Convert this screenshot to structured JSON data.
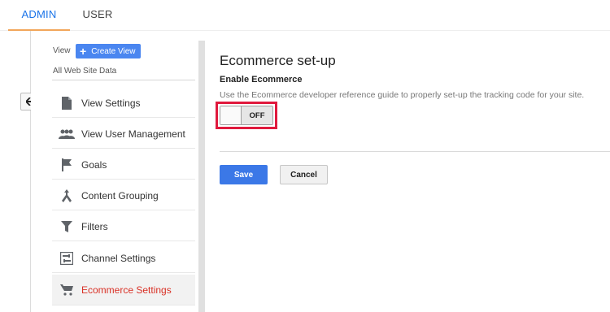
{
  "tabs": [
    {
      "label": "ADMIN",
      "active": true
    },
    {
      "label": "USER",
      "active": false
    }
  ],
  "sidebar": {
    "view_label": "View",
    "create_view_label": "Create View",
    "property_name": "All Web Site Data",
    "items": [
      {
        "label": "View Settings",
        "icon": "document-icon"
      },
      {
        "label": "View User Management",
        "icon": "people-icon"
      },
      {
        "label": "Goals",
        "icon": "flag-icon"
      },
      {
        "label": "Content Grouping",
        "icon": "grouping-icon"
      },
      {
        "label": "Filters",
        "icon": "filter-icon"
      },
      {
        "label": "Channel Settings",
        "icon": "channel-icon"
      },
      {
        "label": "Ecommerce Settings",
        "icon": "cart-icon",
        "active": true
      }
    ]
  },
  "main": {
    "title": "Ecommerce set-up",
    "subtitle": "Enable Ecommerce",
    "description": "Use the Ecommerce developer reference guide to properly set-up the tracking code for your site.",
    "toggle_state": "OFF",
    "save_label": "Save",
    "cancel_label": "Cancel"
  },
  "colors": {
    "accent": "#1a73e8",
    "tab_underline": "#f2a65a",
    "active_item": "#d93025",
    "highlight_border": "#e0193d",
    "save_button": "#3b78e7"
  }
}
